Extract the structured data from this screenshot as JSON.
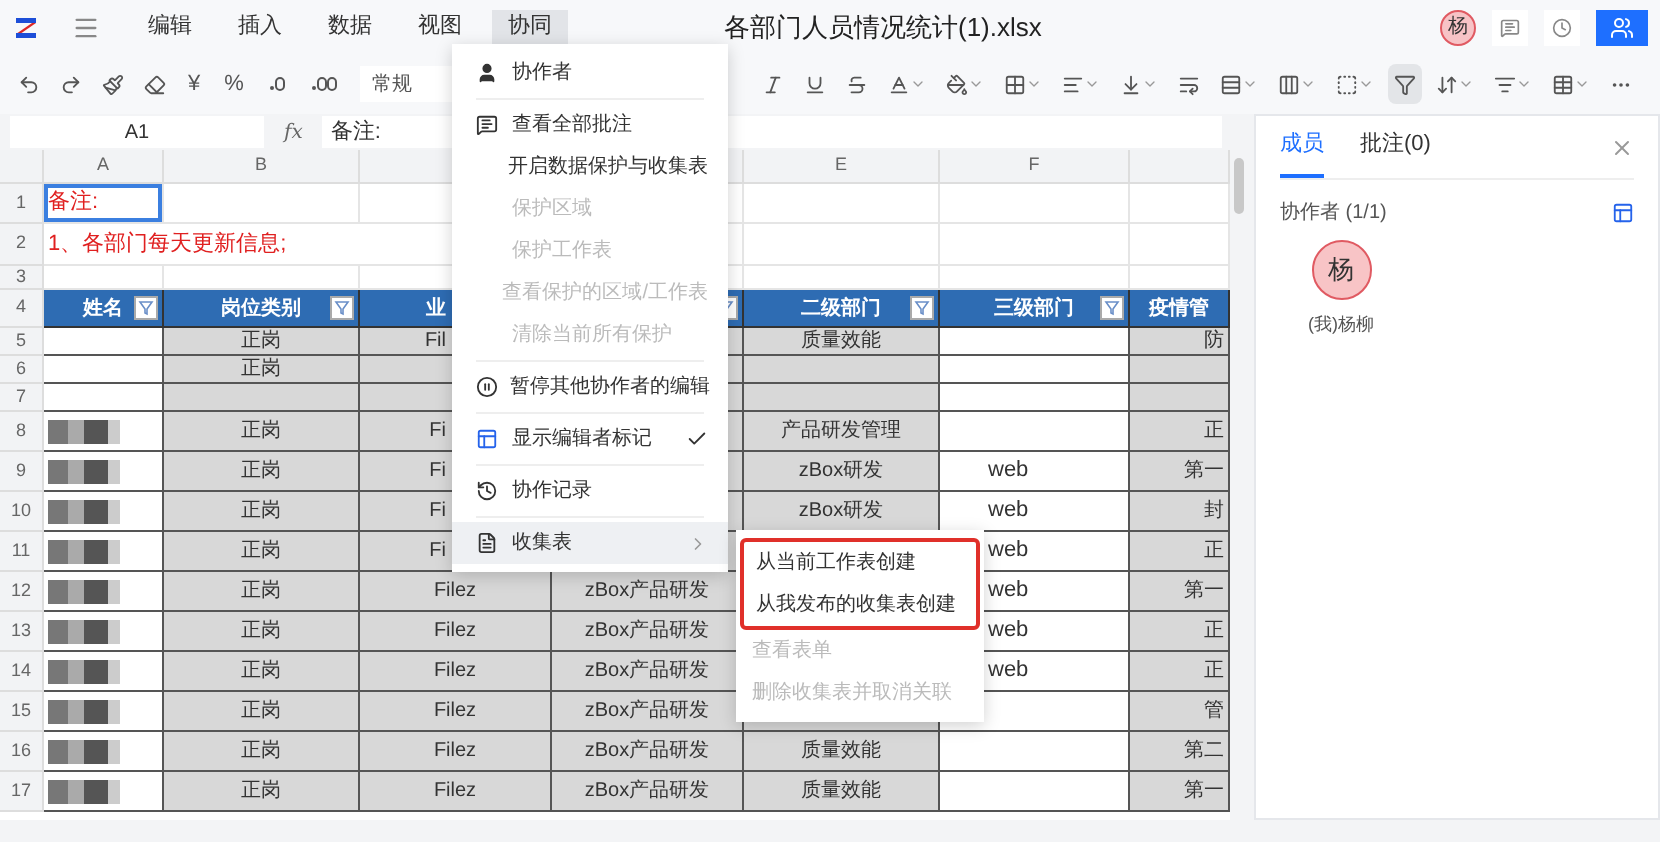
{
  "menubar": {
    "items": [
      {
        "label": "编辑",
        "selected": false
      },
      {
        "label": "插入",
        "selected": false
      },
      {
        "label": "数据",
        "selected": false
      },
      {
        "label": "视图",
        "selected": false
      },
      {
        "label": "协同",
        "selected": true
      }
    ]
  },
  "title": "各部门人员情况统计(1).xlsx",
  "user_avatar": "杨",
  "toolbar": {
    "currency": "¥",
    "percent": "%",
    "format": "常规",
    "filter_active": true
  },
  "formula_bar": {
    "cell": "A1",
    "fx": "fx",
    "value": "备注:"
  },
  "sheet": {
    "columns": [
      "A",
      "B",
      null,
      null,
      "E",
      "F"
    ],
    "rows": [
      {
        "number": "1",
        "kind": "note",
        "cells": [
          {
            "text": "备注:",
            "selected": true
          }
        ]
      },
      {
        "number": "2",
        "kind": "note",
        "cells": [
          "1、各部门每天更新信息;"
        ]
      },
      {
        "number": "3",
        "kind": "note",
        "cells": []
      },
      {
        "number": "4",
        "kind": "header",
        "under_menu": true,
        "cells": [
          {
            "text": "姓名",
            "filter": true
          },
          {
            "text": "岗位类别",
            "filter": true
          },
          {
            "text": "业"
          },
          {
            "filter": true
          },
          {
            "text": "二级部门",
            "filter": true
          },
          {
            "text": "三级部门",
            "filter": true
          },
          {
            "text": "疫情管",
            "filter": false
          }
        ]
      },
      {
        "number": "5",
        "kind": "data",
        "under_menu": true,
        "redacted": false,
        "cells": [
          null,
          "正岗",
          "Fil",
          null,
          "质量效能",
          null,
          "防"
        ]
      },
      {
        "number": "6",
        "kind": "data",
        "redacted": false,
        "cells": [
          null,
          "正岗",
          null,
          null,
          null,
          null,
          null
        ]
      },
      {
        "number": "7",
        "kind": "data",
        "redacted": false,
        "cells": [
          null,
          null,
          null,
          null,
          null,
          null,
          null
        ]
      },
      {
        "number": "8",
        "kind": "data",
        "under_menu": true,
        "redacted": true,
        "cells": [
          null,
          "正岗",
          "Fi",
          null,
          "产品研发管理",
          null,
          "正"
        ]
      },
      {
        "number": "9",
        "kind": "data",
        "under_menu": true,
        "redacted": true,
        "cells": [
          null,
          "正岗",
          "Fi",
          null,
          "zBox研发",
          "web",
          "第一"
        ]
      },
      {
        "number": "10",
        "kind": "data",
        "under_menu": true,
        "redacted": true,
        "cells": [
          null,
          "正岗",
          "Fi",
          null,
          "zBox研发",
          "web",
          "封"
        ]
      },
      {
        "number": "11",
        "kind": "data",
        "under_menu": true,
        "redacted": true,
        "cells": [
          null,
          "正岗",
          "Fi",
          null,
          null,
          "web",
          "正"
        ]
      },
      {
        "number": "12",
        "kind": "data",
        "under_menu": false,
        "redacted": true,
        "cells": [
          null,
          "正岗",
          "Filez",
          "zBox产品研发",
          null,
          "web",
          "第一"
        ]
      },
      {
        "number": "13",
        "kind": "data",
        "under_menu": false,
        "redacted": true,
        "cells": [
          null,
          "正岗",
          "Filez",
          "zBox产品研发",
          null,
          "web",
          "正"
        ]
      },
      {
        "number": "14",
        "kind": "data",
        "under_menu": false,
        "redacted": true,
        "cells": [
          null,
          "正岗",
          "Filez",
          "zBox产品研发",
          null,
          "web",
          "正"
        ]
      },
      {
        "number": "15",
        "kind": "data",
        "under_menu": false,
        "redacted": true,
        "cells": [
          null,
          "正岗",
          "Filez",
          "zBox产品研发",
          null,
          null,
          "管"
        ]
      },
      {
        "number": "16",
        "kind": "data",
        "under_menu": false,
        "redacted": true,
        "cells": [
          null,
          "正岗",
          "Filez",
          "zBox产品研发",
          "质量效能",
          null,
          "第二"
        ]
      },
      {
        "number": "17",
        "kind": "data",
        "under_menu": false,
        "redacted": true,
        "cells": [
          null,
          "正岗",
          "Filez",
          "zBox产品研发",
          "质量效能",
          null,
          "第一"
        ]
      }
    ]
  },
  "menu": {
    "items": [
      {
        "kind": "item",
        "label": "协作者",
        "disabled": false,
        "hovered": false
      },
      {
        "kind": "divider"
      },
      {
        "kind": "item",
        "label": "查看全部批注",
        "disabled": false,
        "hovered": false
      },
      {
        "kind": "item",
        "label": "开启数据保护与收集表",
        "disabled": false,
        "hovered": false
      },
      {
        "kind": "item",
        "label": "保护区域",
        "disabled": true,
        "hovered": false
      },
      {
        "kind": "item",
        "label": "保护工作表",
        "disabled": true,
        "hovered": false
      },
      {
        "kind": "item",
        "label": "查看保护的区域/工作表",
        "disabled": true,
        "hovered": false
      },
      {
        "kind": "item",
        "label": "清除当前所有保护",
        "disabled": true,
        "hovered": false
      },
      {
        "kind": "divider"
      },
      {
        "kind": "item",
        "label": "暂停其他协作者的编辑",
        "disabled": false,
        "hovered": false
      },
      {
        "kind": "divider"
      },
      {
        "kind": "item",
        "label": "显示编辑者标记",
        "disabled": false,
        "hovered": false,
        "checked": true
      },
      {
        "kind": "divider"
      },
      {
        "kind": "item",
        "label": "协作记录",
        "disabled": false,
        "hovered": false
      },
      {
        "kind": "divider"
      },
      {
        "kind": "item",
        "label": "收集表",
        "disabled": false,
        "hovered": true,
        "submenu": true
      }
    ]
  },
  "submenu": {
    "items": [
      {
        "label": "从当前工作表创建",
        "disabled": false,
        "highlighted": true
      },
      {
        "label": "从我发布的收集表创建",
        "disabled": false,
        "highlighted": true
      },
      {
        "label": "查看表单",
        "disabled": true,
        "highlighted": false
      },
      {
        "label": "删除收集表并取消关联",
        "disabled": true,
        "highlighted": false
      }
    ]
  },
  "panel": {
    "tabs": [
      {
        "label": "成员",
        "selected": true
      },
      {
        "label": "批注(0)",
        "selected": false
      }
    ],
    "section": "协作者 (1/1)",
    "members": [
      {
        "avatar": "杨",
        "name": "(我)杨柳"
      }
    ]
  }
}
